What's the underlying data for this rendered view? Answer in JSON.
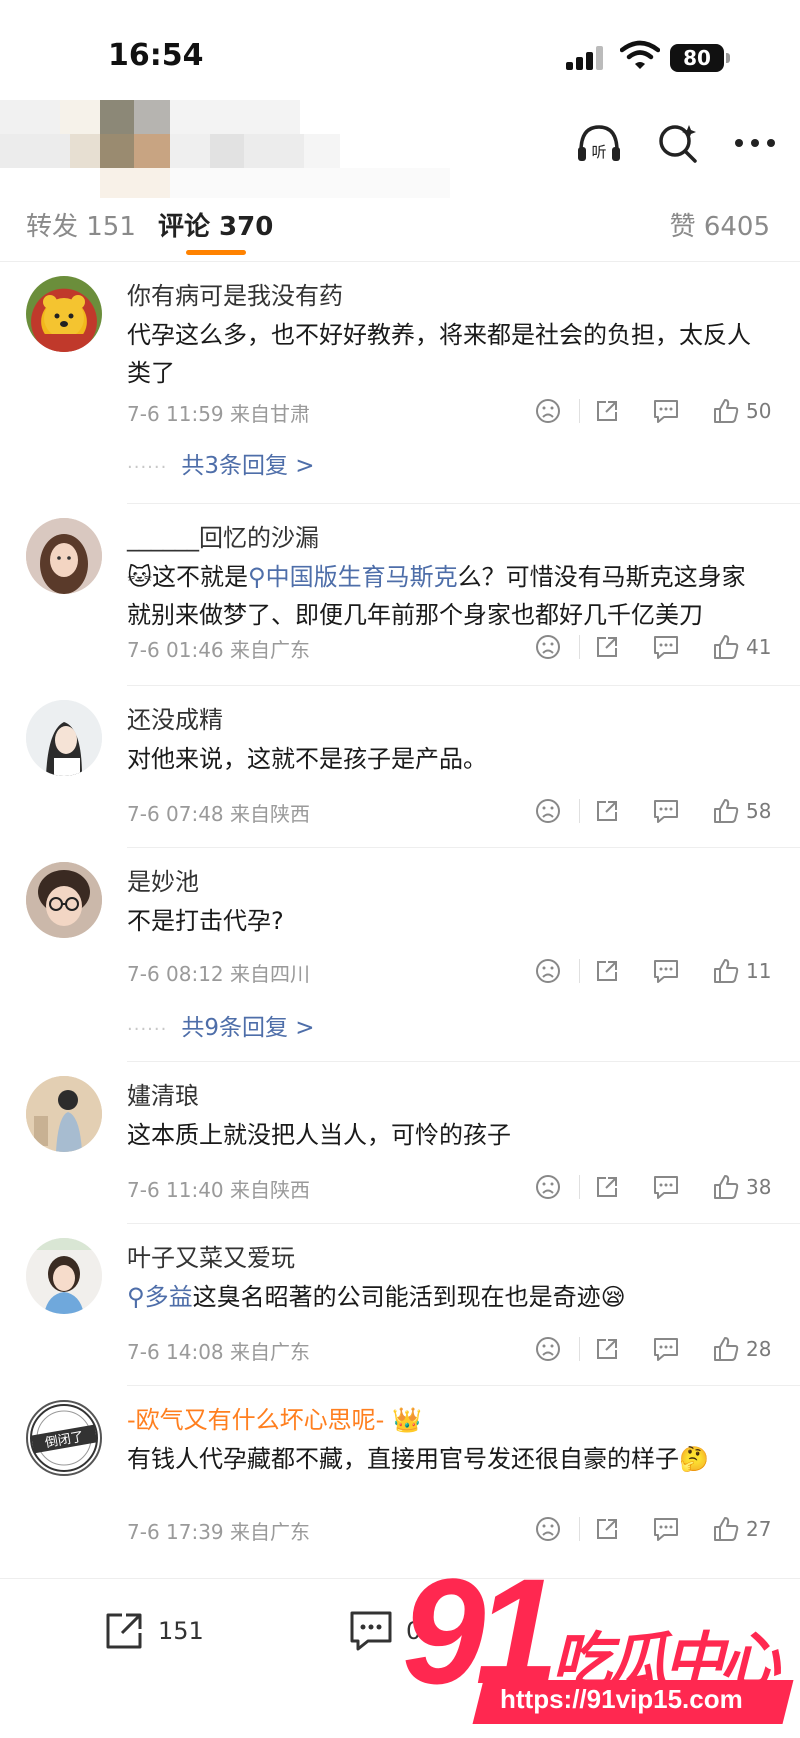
{
  "status_bar": {
    "time": "16:54",
    "battery": "80"
  },
  "tabs": {
    "repost": "转发 151",
    "comment": "评论 370",
    "like": "赞 6405"
  },
  "comments": [
    {
      "username": "你有病可是我没有药",
      "text": "代孕这么多，也不好好教养，将来都是社会的负担，太反人类了",
      "meta": "7-6 11:59 来自甘肃",
      "likes": "50",
      "replies": "共3条回复 >"
    },
    {
      "username": "______回忆的沙漏",
      "text_before": "这不就是",
      "topic": "中国版生育马斯克",
      "text_after": "么？可惜没有马斯克这身家就别来做梦了、即便几年前那个身家也都好几千亿美刀",
      "meta": "7-6 01:46 来自广东",
      "likes": "41"
    },
    {
      "username": "还没成精",
      "text": "对他来说，这就不是孩子是产品。",
      "meta": "7-6 07:48 来自陕西",
      "likes": "58"
    },
    {
      "username": "是妙池",
      "text": "不是打击代孕?",
      "meta": "7-6 08:12 来自四川",
      "likes": "11",
      "replies": "共9条回复 >"
    },
    {
      "username": "嫿清琅",
      "text": "这本质上就没把人当人，可怜的孩子",
      "meta": "7-6 11:40 来自陕西",
      "likes": "38"
    },
    {
      "username": "叶子又菜又爱玩",
      "topic": "多益",
      "text_after": "这臭名昭著的公司能活到现在也是奇迹",
      "meta": "7-6 14:08 来自广东",
      "likes": "28"
    },
    {
      "username": "-欧气又有什么坏心思呢-",
      "avatar_badge": "倒闭了",
      "text": "有钱人代孕藏都不藏，直接用官号发还很自豪的样子",
      "meta": "7-6 17:39 来自广东",
      "likes": "27"
    }
  ],
  "bottom_bar": {
    "repost_count": "151",
    "comment_count": "0"
  },
  "watermark": {
    "number": "91",
    "title": "吃瓜中心",
    "url": "https://91vip15.com"
  },
  "colors": {
    "accent": "#ff8200",
    "topic": "#4e6ea9",
    "watermark": "#ff2850",
    "vip_name": "#ff7f1f"
  }
}
